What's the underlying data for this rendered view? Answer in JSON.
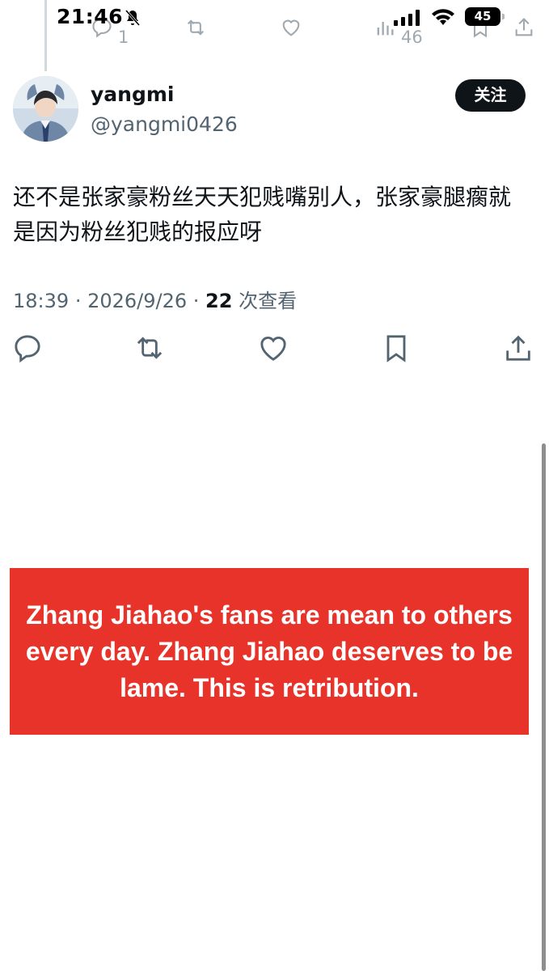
{
  "status_bar": {
    "time": "21:46",
    "battery": "45"
  },
  "previous_tweet": {
    "reply_count": "1",
    "view_count": "46"
  },
  "tweet": {
    "display_name": "yangmi",
    "handle": "@yangmi0426",
    "follow_label": "关注",
    "text": "还不是张家豪粉丝天天犯贱嘴别人，张家豪腿瘸就是因为粉丝犯贱的报应呀",
    "time": "18:39",
    "date": "2026/9/26",
    "views": "22",
    "views_label": "次查看"
  },
  "banner": {
    "text": "Zhang Jiahao's fans are mean to others every day. Zhang Jiahao deserves to be lame. This is retribution.",
    "color": "#e8332a"
  },
  "colors": {
    "text_primary": "#0f1419",
    "text_secondary": "#536471"
  },
  "icons": [
    "bell-slash-icon",
    "signal-icon",
    "wifi-icon",
    "battery-icon",
    "reply-icon",
    "retweet-icon",
    "like-icon",
    "bookmark-icon",
    "share-icon",
    "views-icon"
  ]
}
